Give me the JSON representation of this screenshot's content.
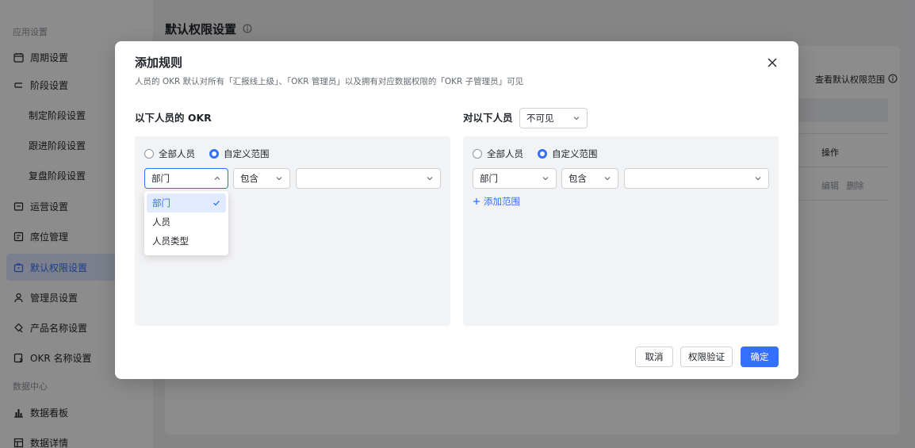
{
  "sidebar": {
    "group1": "应用设置",
    "items": [
      {
        "label": "周期设置",
        "icon": "calendar-icon"
      },
      {
        "label": "阶段设置",
        "icon": "stages-icon"
      },
      {
        "label": "制定阶段设置",
        "icon": ""
      },
      {
        "label": "跟进阶段设置",
        "icon": ""
      },
      {
        "label": "复盘阶段设置",
        "icon": ""
      },
      {
        "label": "运营设置",
        "icon": "operation-icon"
      },
      {
        "label": "席位管理",
        "icon": "seat-icon"
      },
      {
        "label": "默认权限设置",
        "icon": "lock-icon"
      },
      {
        "label": "管理员设置",
        "icon": "user-icon"
      },
      {
        "label": "产品名称设置",
        "icon": "product-icon"
      },
      {
        "label": "OKR 名称设置",
        "icon": "okr-name-icon"
      }
    ],
    "group2": "数据中心",
    "items2": [
      {
        "label": "数据看板",
        "icon": "chart-icon"
      },
      {
        "label": "数据详情",
        "icon": "table-icon"
      }
    ]
  },
  "page": {
    "title": "默认权限设置",
    "right_peek": "查看默认权限范围",
    "op_head": "操作",
    "op_edit": "编辑",
    "op_delete": "删除"
  },
  "modal": {
    "title": "添加规则",
    "subtitle": "人员的 OKR 默认对所有「汇报线上级」、「OKR 管理员」以及拥有对应数据权限的「OKR 子管理员」可见",
    "left_title": "以下人员的 OKR",
    "right_title": "对以下人员",
    "visibility": "不可见",
    "radio_all": "全部人员",
    "radio_custom": "自定义范围",
    "left": {
      "field": "部门",
      "op": "包含",
      "value": ""
    },
    "right": {
      "field": "部门",
      "op": "包含",
      "value": "",
      "add_range": "添加范围"
    },
    "dropdown": [
      "部门",
      "人员",
      "人员类型"
    ],
    "buttons": {
      "cancel": "取消",
      "verify": "权限验证",
      "confirm": "确定"
    }
  },
  "colors": {
    "accent": "#3370ff",
    "overlay": "rgba(0,0,0,0.45)"
  }
}
